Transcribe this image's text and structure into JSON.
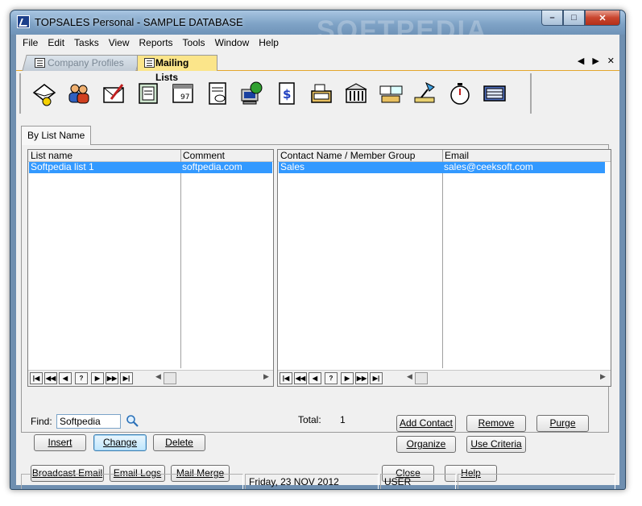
{
  "window": {
    "title": "TOPSALES Personal - SAMPLE DATABASE",
    "watermark": "SOFTPEDIA",
    "minimize": "–",
    "maximize": "□",
    "close": "✕"
  },
  "menu": [
    "File",
    "Edit",
    "Tasks",
    "View",
    "Reports",
    "Tools",
    "Window",
    "Help"
  ],
  "tabs": [
    {
      "label": "Company Profiles",
      "active": false
    },
    {
      "label": "Mailing Lists",
      "active": true
    }
  ],
  "tabnav": {
    "prev": "◀",
    "next": "▶",
    "close": "✕"
  },
  "toolbar_icons": [
    "envelope-icon",
    "contacts-icon",
    "letter-icon",
    "address-book-icon",
    "calendar-icon",
    "document-icon",
    "globe-computer-icon",
    "dollar-document-icon",
    "cash-register-icon",
    "bank-icon",
    "group-icon",
    "lamp-icon",
    "stopwatch-icon",
    "calculator-icon"
  ],
  "view_tab": "By List Name",
  "lists_grid": {
    "columns": [
      "List name",
      "Comment"
    ],
    "rows": [
      [
        "Softpedia list 1",
        "softpedia.com"
      ]
    ]
  },
  "members_grid": {
    "columns": [
      "Contact Name / Member Group",
      "Email"
    ],
    "rows": [
      [
        "Sales",
        "sales@ceeksoft.com"
      ]
    ]
  },
  "nav_buttons": [
    "|◀",
    "◀◀",
    "◀",
    "?",
    "▶",
    "▶▶",
    "▶|"
  ],
  "find": {
    "label": "Find:",
    "value": "Softpedia"
  },
  "total": {
    "label": "Total:",
    "value": "1"
  },
  "buttons": {
    "insert": "Insert",
    "change": "Change",
    "delete": "Delete",
    "add_contact": "Add Contact",
    "remove": "Remove",
    "purge": "Purge",
    "organize": "Organize",
    "use_criteria": "Use Criteria",
    "broadcast_email": "Broadcast Email",
    "email_logs": "Email Logs",
    "mail_merge": "Mail Merge",
    "close": "Close",
    "help": "Help"
  },
  "status": {
    "date": "Friday, 23 NOV 2012",
    "user": "USER"
  }
}
